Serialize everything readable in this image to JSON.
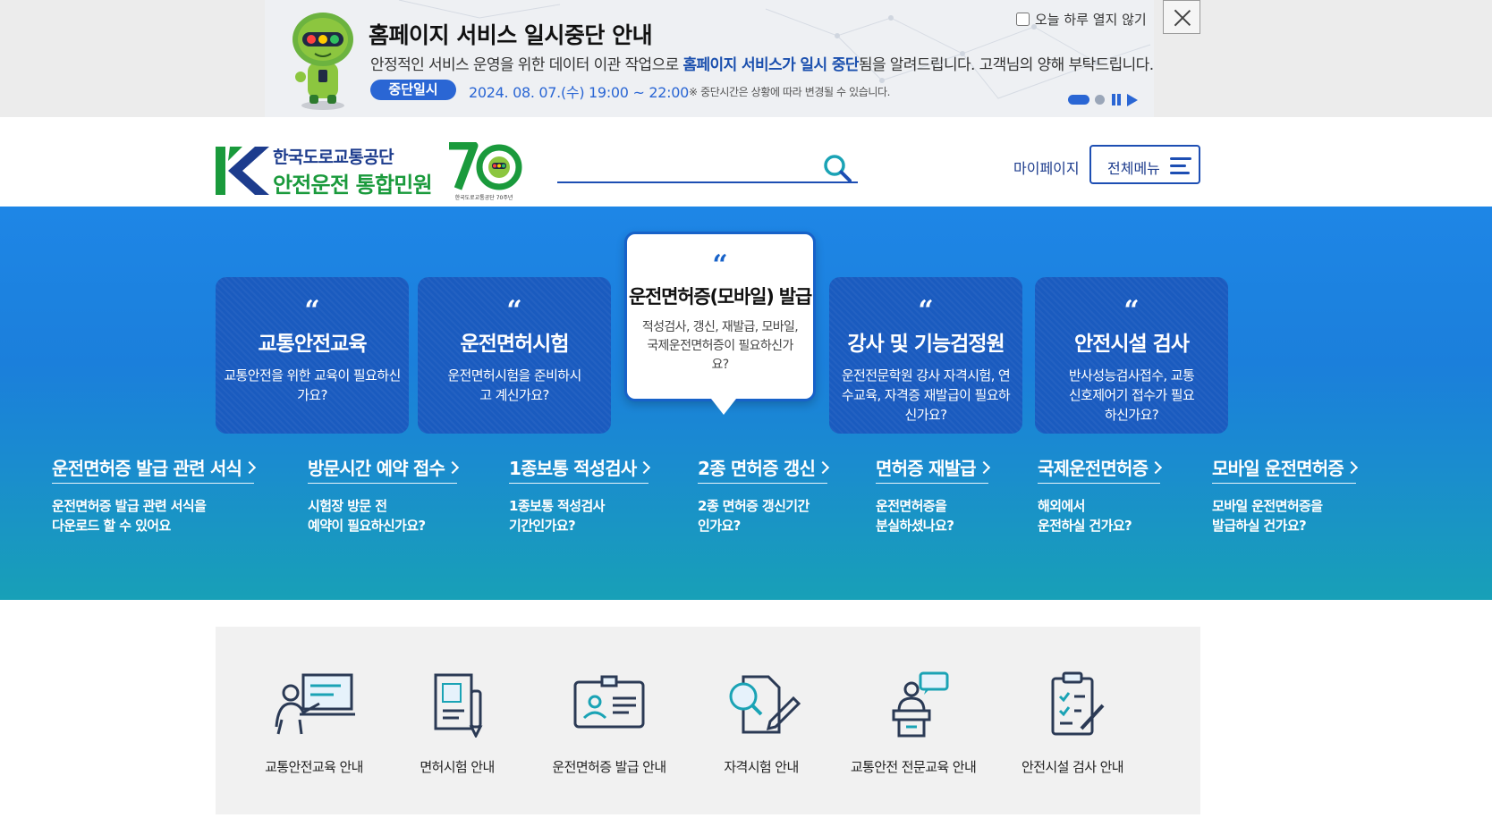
{
  "notice": {
    "title": "홈페이지 서비스 일시중단 안내",
    "desc_before": "안정적인 서비스 운영을 위한 데이터 이관 작업으로 ",
    "desc_highlight": "홈페이지 서비스가 일시 중단",
    "desc_after": "됨을 알려드립니다. 고객님의 양해 부탁드립니다.",
    "badge": "중단일시",
    "time": "2024. 08. 07.(수) 19:00 ~ 22:00",
    "note": "※ 중단시간은 상황에 따라 변경될 수 있습니다.",
    "no_show_label": "오늘 하루 열지 않기"
  },
  "header": {
    "logo_line1": "한국도로교통공단",
    "logo_line2": "안전운전 통합민원",
    "anniversary_caption": "한국도로교통공단 70주년",
    "search_placeholder": "",
    "mypage": "마이페이지",
    "allmenu": "전체메뉴"
  },
  "cards": [
    {
      "title": "교통안전교육",
      "desc": "교통안전을 위한 교육이 필요하신가요?"
    },
    {
      "title": "운전면허시험",
      "desc": "운전면허시험을 준비하시고 계신가요?"
    },
    {
      "title": "운전면허증(모바일) 발급",
      "desc": "적성검사, 갱신, 재발급, 모바일, 국제운전면허증이 필요하신가요?"
    },
    {
      "title": "강사 및 기능검정원",
      "desc": "운전전문학원 강사 자격시험, 연수교육, 자격증 재발급이 필요하신가요?"
    },
    {
      "title": "안전시설 검사",
      "desc": "반사성능검사접수, 교통신호제어기 접수가 필요하신가요?"
    }
  ],
  "quick_links": [
    {
      "title": "운전면허증 발급 관련 서식",
      "line1": "운전면허증 발급 관련 서식을",
      "line2": "다운로드 할 수 있어요"
    },
    {
      "title": "방문시간 예약 접수",
      "line1": "시험장 방문 전",
      "line2": "예약이 필요하신가요?"
    },
    {
      "title": "1종보통 적성검사",
      "line1": "1종보통 적성검사",
      "line2": "기간인가요?"
    },
    {
      "title": "2종 면허증 갱신",
      "line1": "2종 면허증 갱신기간",
      "line2": "인가요?"
    },
    {
      "title": "면허증 재발급",
      "line1": "운전면허증을",
      "line2": "분실하셨나요?"
    },
    {
      "title": "국제운전면허증",
      "line1": "해외에서",
      "line2": "운전하실 건가요?"
    },
    {
      "title": "모바일 운전면허증",
      "line1": "모바일 운전면허증을",
      "line2": "발급하실 건가요?"
    }
  ],
  "guides": [
    {
      "label": "교통안전교육 안내",
      "icon": "lecture-icon"
    },
    {
      "label": "면허시험 안내",
      "icon": "exam-document-icon"
    },
    {
      "label": "운전면허증 발급 안내",
      "icon": "id-card-icon"
    },
    {
      "label": "자격시험 안내",
      "icon": "certificate-exam-icon"
    },
    {
      "label": "교통안전 전문교육 안내",
      "icon": "speaker-podium-icon"
    },
    {
      "label": "안전시설 검사 안내",
      "icon": "checklist-clipboard-icon"
    }
  ],
  "colors": {
    "primary_blue": "#1d4eb3",
    "brand_green": "#1a9a3c",
    "card_blue": "#1a5bbf"
  }
}
